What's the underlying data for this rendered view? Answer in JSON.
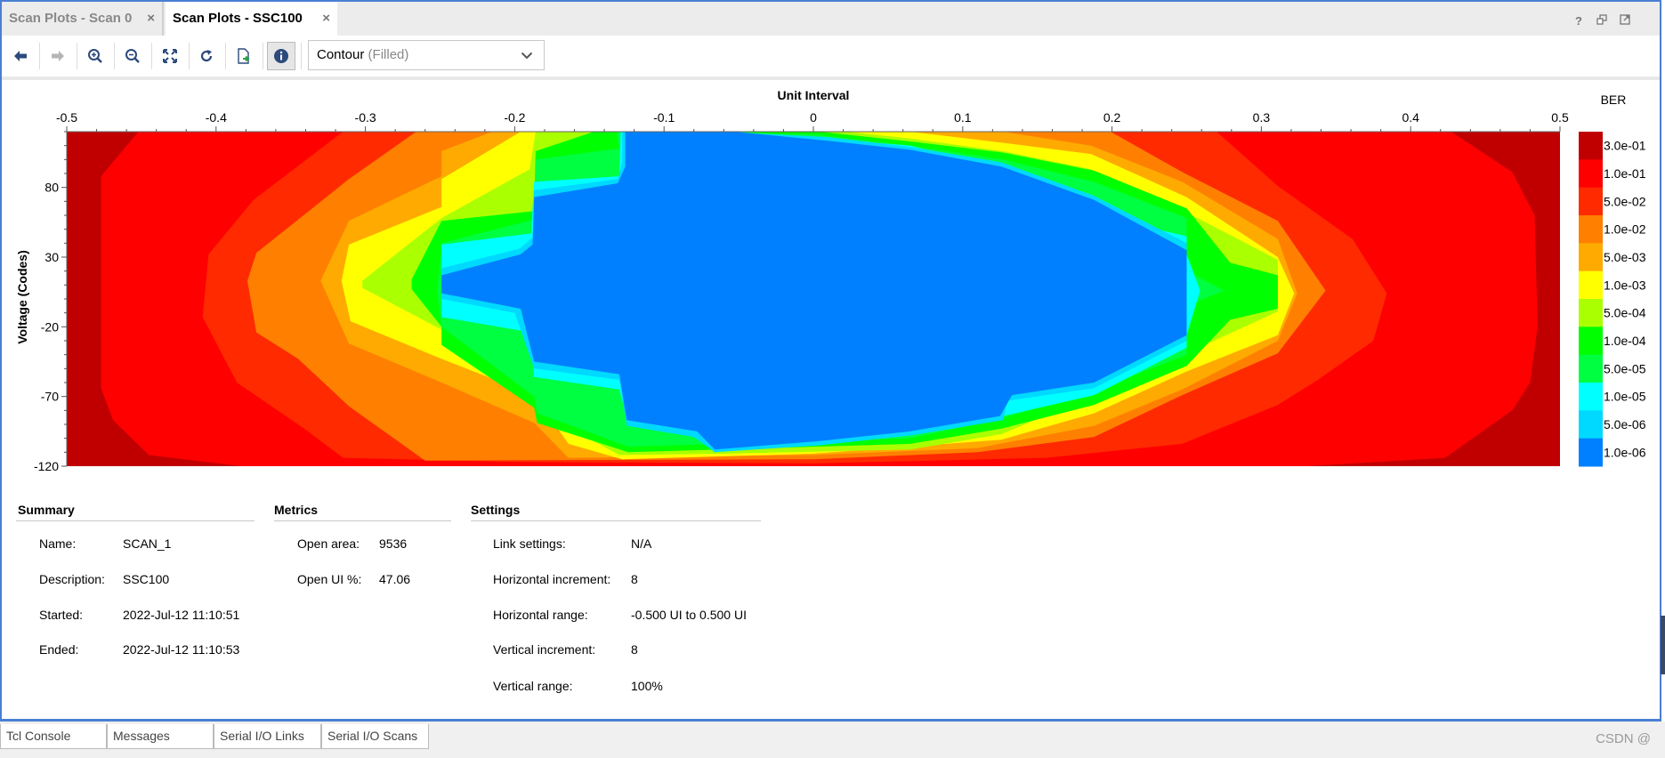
{
  "window": {
    "tabs": [
      {
        "label": "Scan Plots - Scan 0",
        "active": false
      },
      {
        "label": "Scan Plots - SSC100",
        "active": true
      }
    ],
    "close_glyph": "×",
    "window_icons": [
      "help-icon",
      "restore-icon",
      "float-icon"
    ],
    "help_glyph": "?"
  },
  "toolbar": {
    "buttons": [
      "back-icon",
      "forward-icon",
      "zoom-in-icon",
      "zoom-out-icon",
      "fit-icon",
      "refresh-icon",
      "export-icon",
      "info-icon"
    ],
    "plot_type": {
      "value": "Contour",
      "qualifier": "(Filled)"
    }
  },
  "chart_data": {
    "type": "heatmap",
    "style": "filled-contour",
    "xlabel": "Unit Interval",
    "ylabel": "Voltage (Codes)",
    "xlim": [
      -0.5,
      0.5
    ],
    "ylim": [
      -120,
      120
    ],
    "xticks": [
      "-0.5",
      "-0.4",
      "-0.3",
      "-0.2",
      "-0.1",
      "0",
      "0.1",
      "0.2",
      "0.3",
      "0.4",
      "0.5"
    ],
    "yticks": [
      "80",
      "30",
      "-20",
      "-70",
      "-120"
    ],
    "ytick_values": [
      80,
      30,
      -20,
      -70,
      -120
    ],
    "colorbar_title": "BER",
    "levels": [
      {
        "label": "3.0e-01",
        "color": "#c00000"
      },
      {
        "label": "1.0e-01",
        "color": "#ff0000"
      },
      {
        "label": "5.0e-02",
        "color": "#ff2a00"
      },
      {
        "label": "1.0e-02",
        "color": "#ff8000"
      },
      {
        "label": "5.0e-03",
        "color": "#ffaa00"
      },
      {
        "label": "1.0e-03",
        "color": "#ffff00"
      },
      {
        "label": "5.0e-04",
        "color": "#aaff00"
      },
      {
        "label": "1.0e-04",
        "color": "#00ff00"
      },
      {
        "label": "5.0e-05",
        "color": "#00ff40"
      },
      {
        "label": "1.0e-05",
        "color": "#00ffff"
      },
      {
        "label": "5.0e-06",
        "color": "#00d9ff"
      },
      {
        "label": "1.0e-06",
        "color": "#0080ff"
      }
    ],
    "contours": [
      {
        "level": "1.0e-01",
        "points": [
          [
            -0.452,
            120
          ],
          [
            0.427,
            120
          ],
          [
            0.468,
            91
          ],
          [
            0.483,
            60
          ],
          [
            0.485,
            -20
          ],
          [
            0.48,
            -60
          ],
          [
            0.468,
            -80
          ],
          [
            0.423,
            -114
          ],
          [
            0.33,
            -120
          ],
          [
            -0.383,
            -120
          ],
          [
            -0.445,
            -112
          ],
          [
            -0.469,
            -87
          ],
          [
            -0.477,
            -64
          ],
          [
            -0.477,
            88
          ]
        ]
      },
      {
        "level": "5.0e-02",
        "points": [
          [
            -0.315,
            120
          ],
          [
            0.27,
            120
          ],
          [
            0.311,
            81
          ],
          [
            0.361,
            43
          ],
          [
            0.384,
            4
          ],
          [
            0.375,
            -30
          ],
          [
            0.338,
            -58
          ],
          [
            0.311,
            -76
          ],
          [
            0.247,
            -104
          ],
          [
            0.156,
            -114
          ],
          [
            0,
            -118
          ],
          [
            -0.2,
            -117
          ],
          [
            -0.315,
            -114
          ],
          [
            -0.341,
            -93
          ],
          [
            -0.386,
            -60
          ],
          [
            -0.409,
            -13
          ],
          [
            -0.405,
            32
          ],
          [
            -0.375,
            71
          ]
        ]
      },
      {
        "level": "1.0e-02",
        "points": [
          [
            -0.266,
            120
          ],
          [
            0.199,
            120
          ],
          [
            0.247,
            91
          ],
          [
            0.311,
            56
          ],
          [
            0.343,
            6
          ],
          [
            0.311,
            -39
          ],
          [
            0.247,
            -69
          ],
          [
            0.188,
            -99
          ],
          [
            0.11,
            -110
          ],
          [
            0,
            -115
          ],
          [
            -0.26,
            -116
          ],
          [
            -0.311,
            -77
          ],
          [
            -0.345,
            -43
          ],
          [
            -0.373,
            -24
          ],
          [
            -0.379,
            13
          ],
          [
            -0.373,
            33
          ],
          [
            -0.311,
            86
          ]
        ]
      },
      {
        "level": "5.0e-03",
        "points": [
          [
            -0.215,
            120
          ],
          [
            0.127,
            120
          ],
          [
            0.186,
            110
          ],
          [
            0.247,
            84
          ],
          [
            0.311,
            43
          ],
          [
            0.324,
            4
          ],
          [
            0.311,
            -30
          ],
          [
            0.247,
            -65
          ],
          [
            0.188,
            -91
          ],
          [
            0.11,
            -107
          ],
          [
            0,
            -112
          ],
          [
            -0.164,
            -114
          ],
          [
            -0.187,
            -89
          ],
          [
            -0.249,
            -60
          ],
          [
            -0.311,
            -32
          ],
          [
            -0.33,
            13
          ],
          [
            -0.311,
            56
          ],
          [
            -0.249,
            88
          ],
          [
            -0.249,
            106
          ]
        ]
      },
      {
        "level": "1.0e-03",
        "points": [
          [
            -0.196,
            120
          ],
          [
            0.065,
            120
          ],
          [
            0.127,
            112
          ],
          [
            0.186,
            104
          ],
          [
            0.25,
            73
          ],
          [
            0.311,
            30
          ],
          [
            0.322,
            4
          ],
          [
            0.311,
            -26
          ],
          [
            0.25,
            -52
          ],
          [
            0.188,
            -82
          ],
          [
            0.126,
            -101
          ],
          [
            0,
            -111
          ],
          [
            -0.128,
            -115
          ],
          [
            -0.164,
            -104
          ],
          [
            -0.187,
            -69
          ],
          [
            -0.249,
            -43
          ],
          [
            -0.31,
            -16
          ],
          [
            -0.316,
            13
          ],
          [
            -0.311,
            39
          ],
          [
            -0.249,
            66
          ],
          [
            -0.249,
            86
          ]
        ]
      },
      {
        "level": "5.0e-04",
        "points": [
          [
            -0.186,
            120
          ],
          [
            0.022,
            120
          ],
          [
            0.065,
            115
          ],
          [
            0.127,
            106
          ],
          [
            0.186,
            93
          ],
          [
            0.25,
            62
          ],
          [
            0.311,
            28
          ],
          [
            0.311,
            -9
          ],
          [
            0.25,
            -39
          ],
          [
            0.188,
            -69
          ],
          [
            0.126,
            -97
          ],
          [
            0.065,
            -108
          ],
          [
            -0.058,
            -111
          ],
          [
            -0.13,
            -112
          ],
          [
            -0.166,
            -91
          ],
          [
            -0.187,
            -63
          ],
          [
            -0.249,
            -22
          ],
          [
            -0.302,
            8
          ],
          [
            -0.302,
            13
          ],
          [
            -0.249,
            58
          ],
          [
            -0.19,
            93
          ]
        ]
      },
      {
        "level": "1.0e-04",
        "points": [
          [
            -0.147,
            120
          ],
          [
            0.004,
            120
          ],
          [
            0.065,
            113
          ],
          [
            0.127,
            105
          ],
          [
            0.188,
            92
          ],
          [
            0.25,
            65
          ],
          [
            0.279,
            26
          ],
          [
            0.311,
            17
          ],
          [
            0.311,
            -7
          ],
          [
            0.279,
            -15
          ],
          [
            0.25,
            -48
          ],
          [
            0.188,
            -76
          ],
          [
            0.126,
            -93
          ],
          [
            0.065,
            -104
          ],
          [
            -0.124,
            -110
          ],
          [
            -0.185,
            -89
          ],
          [
            -0.187,
            -78
          ],
          [
            -0.249,
            -33
          ],
          [
            -0.249,
            -20
          ],
          [
            -0.269,
            7
          ],
          [
            -0.269,
            14
          ],
          [
            -0.249,
            56
          ],
          [
            -0.187,
            63
          ],
          [
            -0.186,
            106
          ]
        ]
      },
      {
        "level": "5.0e-05",
        "points": [
          [
            -0.132,
            120
          ],
          [
            0.0,
            118
          ],
          [
            0.065,
            110
          ],
          [
            0.127,
            100
          ],
          [
            0.188,
            84
          ],
          [
            0.25,
            58
          ],
          [
            0.25,
            20
          ],
          [
            0.275,
            6
          ],
          [
            0.25,
            -5
          ],
          [
            0.25,
            -40
          ],
          [
            0.188,
            -66
          ],
          [
            0.126,
            -86
          ],
          [
            0.065,
            -100
          ],
          [
            -0.124,
            -106
          ],
          [
            -0.185,
            -82
          ],
          [
            -0.187,
            -70
          ],
          [
            -0.249,
            -20
          ],
          [
            -0.252,
            5
          ],
          [
            -0.249,
            40
          ],
          [
            -0.187,
            57
          ],
          [
            -0.186,
            100
          ],
          [
            -0.13,
            108
          ]
        ]
      },
      {
        "level": "1.0e-05",
        "points": [
          [
            -0.129,
            120
          ],
          [
            -0.053,
            120
          ],
          [
            0.004,
            115
          ],
          [
            0.065,
            110
          ],
          [
            0.11,
            97
          ],
          [
            0.126,
            86
          ],
          [
            0.188,
            60
          ],
          [
            0.25,
            45
          ],
          [
            0.25,
            32
          ],
          [
            0.259,
            6
          ],
          [
            0.25,
            -26
          ],
          [
            0.25,
            -35
          ],
          [
            0.188,
            -69
          ],
          [
            0.127,
            -84
          ],
          [
            0.065,
            -97
          ],
          [
            0.004,
            -104
          ],
          [
            -0.066,
            -108
          ],
          [
            -0.078,
            -97
          ],
          [
            -0.124,
            -89
          ],
          [
            -0.13,
            -65
          ],
          [
            -0.187,
            -56
          ],
          [
            -0.189,
            -24
          ],
          [
            -0.249,
            -13
          ],
          [
            -0.249,
            39
          ],
          [
            -0.189,
            47
          ],
          [
            -0.187,
            84
          ],
          [
            -0.13,
            88
          ]
        ]
      },
      {
        "level": "5.0e-06",
        "points": [
          [
            -0.128,
            120
          ],
          [
            -0.06,
            120
          ],
          [
            0.01,
            116
          ],
          [
            0.065,
            109
          ],
          [
            0.126,
            98
          ],
          [
            0.188,
            74
          ],
          [
            0.25,
            40
          ],
          [
            0.25,
            -30
          ],
          [
            0.188,
            -64
          ],
          [
            0.13,
            -73
          ],
          [
            0.127,
            -87
          ],
          [
            0.065,
            -98
          ],
          [
            0.004,
            -105
          ],
          [
            -0.066,
            -110
          ],
          [
            -0.08,
            -99
          ],
          [
            -0.125,
            -91
          ],
          [
            -0.13,
            -58
          ],
          [
            -0.187,
            -50
          ],
          [
            -0.2,
            -10
          ],
          [
            -0.249,
            0
          ],
          [
            -0.249,
            22
          ],
          [
            -0.197,
            36
          ],
          [
            -0.188,
            44
          ],
          [
            -0.187,
            78
          ],
          [
            -0.131,
            86
          ],
          [
            -0.128,
            98
          ]
        ]
      },
      {
        "level": "1.0e-06",
        "points": [
          [
            -0.126,
            120
          ],
          [
            -0.053,
            120
          ],
          [
            0.014,
            113
          ],
          [
            0.065,
            107
          ],
          [
            0.126,
            95
          ],
          [
            0.188,
            71
          ],
          [
            0.25,
            35
          ],
          [
            0.25,
            -26
          ],
          [
            0.188,
            -60
          ],
          [
            0.133,
            -69
          ],
          [
            0.125,
            -84
          ],
          [
            0.065,
            -95
          ],
          [
            0.004,
            -102
          ],
          [
            -0.066,
            -108
          ],
          [
            -0.078,
            -95
          ],
          [
            -0.125,
            -87
          ],
          [
            -0.13,
            -54
          ],
          [
            -0.187,
            -45
          ],
          [
            -0.196,
            -7
          ],
          [
            -0.249,
            4
          ],
          [
            -0.249,
            17
          ],
          [
            -0.196,
            32
          ],
          [
            -0.188,
            39
          ],
          [
            -0.187,
            73
          ],
          [
            -0.131,
            83
          ],
          [
            -0.126,
            95
          ]
        ]
      }
    ]
  },
  "summary": {
    "title": "Summary",
    "rows": [
      {
        "label": "Name:",
        "value": "SCAN_1"
      },
      {
        "label": "Description:",
        "value": "SSC100"
      },
      {
        "label": "Started:",
        "value": "2022-Jul-12 11:10:51"
      },
      {
        "label": "Ended:",
        "value": "2022-Jul-12 11:10:53"
      }
    ]
  },
  "metrics": {
    "title": "Metrics",
    "rows": [
      {
        "label": "Open area:",
        "value": "9536"
      },
      {
        "label": "Open UI %:",
        "value": "47.06"
      }
    ]
  },
  "settings": {
    "title": "Settings",
    "rows": [
      {
        "label": "Link settings:",
        "value": "N/A"
      },
      {
        "label": "Horizontal increment:",
        "value": "8"
      },
      {
        "label": "Horizontal range:",
        "value": "-0.500 UI to 0.500 UI"
      },
      {
        "label": "Vertical increment:",
        "value": "8"
      },
      {
        "label": "Vertical range:",
        "value": "100%"
      }
    ]
  },
  "bottom_tabs": [
    "Tcl Console",
    "Messages",
    "Serial I/O Links",
    "Serial I/O Scans"
  ],
  "watermark": "CSDN @小风兮兮",
  "colors": {
    "frame_border": "#4a7fd4",
    "accent": "#2c4a7c"
  }
}
